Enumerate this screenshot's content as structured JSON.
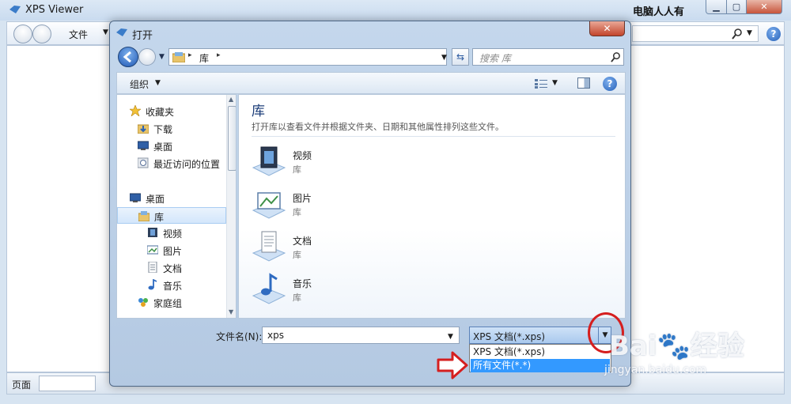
{
  "background_window": {
    "title": "XPS Viewer",
    "brand": "电脑人人有",
    "file_menu": "文件",
    "status_page_label": "页面",
    "icons": [
      "xps-app-icon",
      "back-icon",
      "forward-icon",
      "search-icon",
      "help-icon"
    ]
  },
  "dialog": {
    "title": "打开",
    "address": {
      "location": "库",
      "sep": "▸"
    },
    "search_placeholder": "搜索 库",
    "toolbar": {
      "organize": "组织"
    },
    "nav_pane": {
      "items": [
        {
          "label": "收藏夹",
          "icon": "star-icon"
        },
        {
          "label": "下载",
          "icon": "downloads-folder-icon"
        },
        {
          "label": "桌面",
          "icon": "desktop-icon"
        },
        {
          "label": "最近访问的位置",
          "icon": "recent-places-icon"
        },
        {
          "label": "桌面",
          "icon": "desktop-icon"
        },
        {
          "label": "库",
          "icon": "library-icon",
          "selected": true
        },
        {
          "label": "视频",
          "icon": "video-icon"
        },
        {
          "label": "图片",
          "icon": "pictures-icon"
        },
        {
          "label": "文档",
          "icon": "documents-icon"
        },
        {
          "label": "音乐",
          "icon": "music-icon"
        },
        {
          "label": "家庭组",
          "icon": "homegroup-icon"
        }
      ]
    },
    "main_pane": {
      "heading": "库",
      "description": "打开库以查看文件并根据文件夹、日期和其他属性排列这些文件。",
      "libraries": [
        {
          "name": "视频",
          "type": "库",
          "icon": "video-library-icon"
        },
        {
          "name": "图片",
          "type": "库",
          "icon": "pictures-library-icon"
        },
        {
          "name": "文档",
          "type": "库",
          "icon": "documents-library-icon"
        },
        {
          "name": "音乐",
          "type": "库",
          "icon": "music-library-icon"
        }
      ]
    },
    "filename": {
      "label": "文件名(N):",
      "value": "xps"
    },
    "filetype": {
      "selected": "XPS 文档(*.xps)",
      "options": [
        "XPS 文档(*.xps)",
        "所有文件(*.*)"
      ],
      "highlighted_index": 1
    },
    "colors": {
      "highlight": "#3399ff",
      "annotation_red": "#d51f1f"
    }
  },
  "watermark": {
    "logo": "Bai🐾经验",
    "url": "jingyan.baidu.com"
  }
}
